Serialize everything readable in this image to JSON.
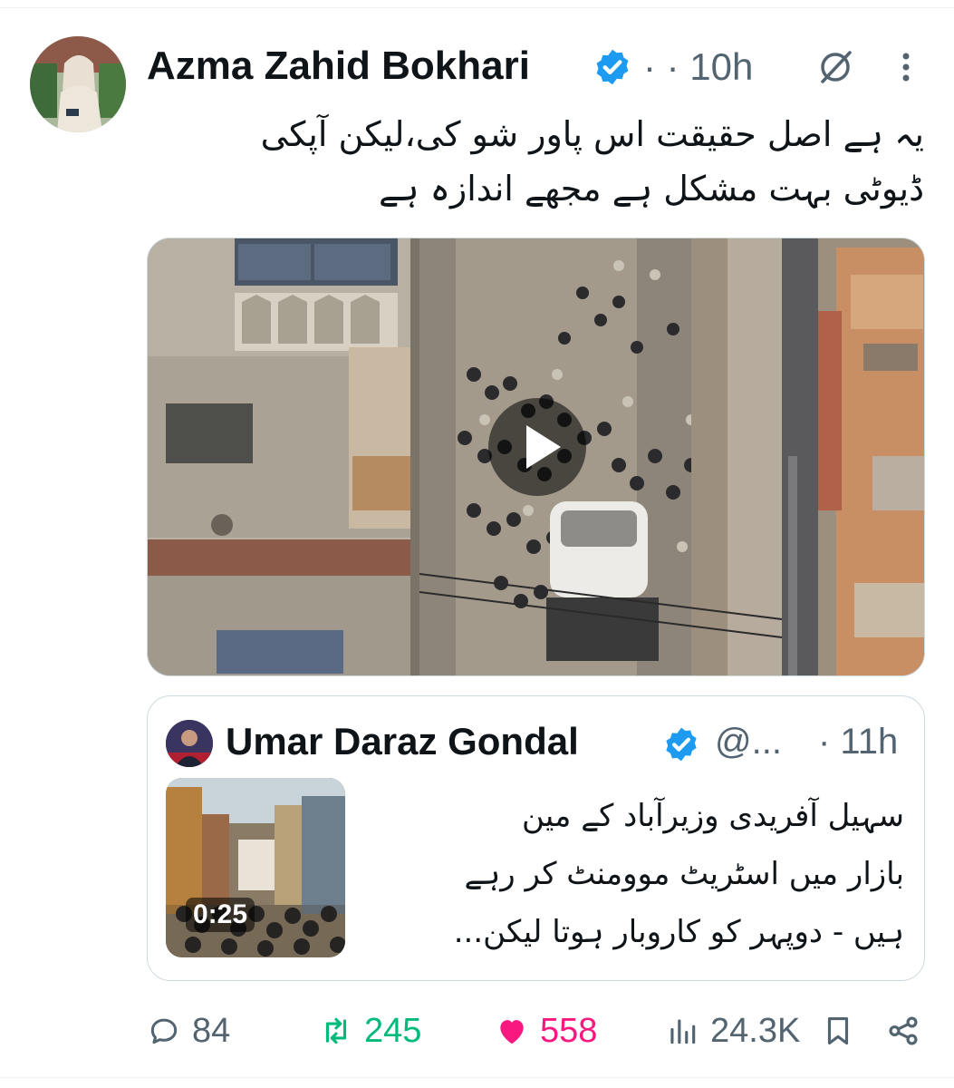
{
  "post": {
    "author_name": "Azma Zahid Bokhari",
    "meta": "· · 10h",
    "text_line1": "یہ ہے اصل حقیقت اس پاور شو کی،لیکن آپکی",
    "text_line2": "ڈیوٹی بہت مشکل ہے مجھے اندازہ ہے",
    "icons": {
      "verified": "verified-badge-icon",
      "grok": "grok-icon",
      "more": "more-vertical-icon",
      "play": "play-icon"
    }
  },
  "quote": {
    "author_name": "Umar Daraz Gondal",
    "handle": "@...",
    "time": "· 11h",
    "duration": "0:25",
    "text_line1": "سہیل آفریدی وزیرآباد کے مین",
    "text_line2": "بازار میں اسٹریٹ موومنٹ کر رہے",
    "text_line3": "ہیں - دوپہر کو کاروبار ہوتا لیکن..."
  },
  "actions": {
    "replies": "84",
    "reposts": "245",
    "likes": "558",
    "views": "24.3K",
    "icons": [
      "reply-icon",
      "repost-icon",
      "like-icon",
      "views-icon",
      "bookmark-icon",
      "share-icon"
    ]
  },
  "colors": {
    "text": "#0f1419",
    "secondary": "#536471",
    "verified": "#1d9bf0",
    "repost": "#00ba7c",
    "like": "#f91880",
    "border": "#cfd9de"
  }
}
